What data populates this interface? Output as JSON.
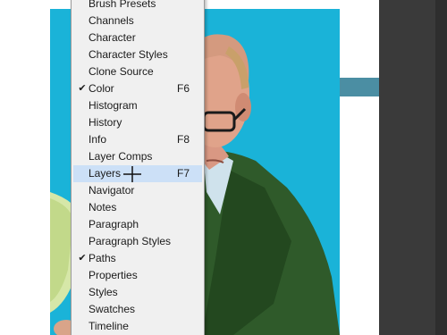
{
  "colors": {
    "canvas_background": "#1ab3d8",
    "menu_background": "#f0f0f0",
    "menu_hover": "#cce0f7",
    "panel_accent": "#4b8ea3",
    "dark_panel": "#3a3a3a"
  },
  "menu": {
    "items": [
      {
        "label": "Brush Presets",
        "checked": false,
        "shortcut": ""
      },
      {
        "label": "Channels",
        "checked": false,
        "shortcut": ""
      },
      {
        "label": "Character",
        "checked": false,
        "shortcut": ""
      },
      {
        "label": "Character Styles",
        "checked": false,
        "shortcut": ""
      },
      {
        "label": "Clone Source",
        "checked": false,
        "shortcut": ""
      },
      {
        "label": "Color",
        "checked": true,
        "check_mark": "✔",
        "shortcut": "F6"
      },
      {
        "label": "Histogram",
        "checked": false,
        "shortcut": ""
      },
      {
        "label": "History",
        "checked": false,
        "shortcut": ""
      },
      {
        "label": "Info",
        "checked": false,
        "shortcut": "F8"
      },
      {
        "label": "Layer Comps",
        "checked": false,
        "shortcut": ""
      },
      {
        "label": "Layers",
        "checked": false,
        "shortcut": "F7",
        "hovered": true
      },
      {
        "label": "Navigator",
        "checked": false,
        "shortcut": ""
      },
      {
        "label": "Notes",
        "checked": false,
        "shortcut": ""
      },
      {
        "label": "Paragraph",
        "checked": false,
        "shortcut": ""
      },
      {
        "label": "Paragraph Styles",
        "checked": false,
        "shortcut": ""
      },
      {
        "label": "Paths",
        "checked": true,
        "check_mark": "✔",
        "shortcut": ""
      },
      {
        "label": "Properties",
        "checked": false,
        "shortcut": ""
      },
      {
        "label": "Styles",
        "checked": false,
        "shortcut": ""
      },
      {
        "label": "Swatches",
        "checked": false,
        "shortcut": ""
      },
      {
        "label": "Timeline",
        "checked": false,
        "shortcut": ""
      }
    ]
  }
}
